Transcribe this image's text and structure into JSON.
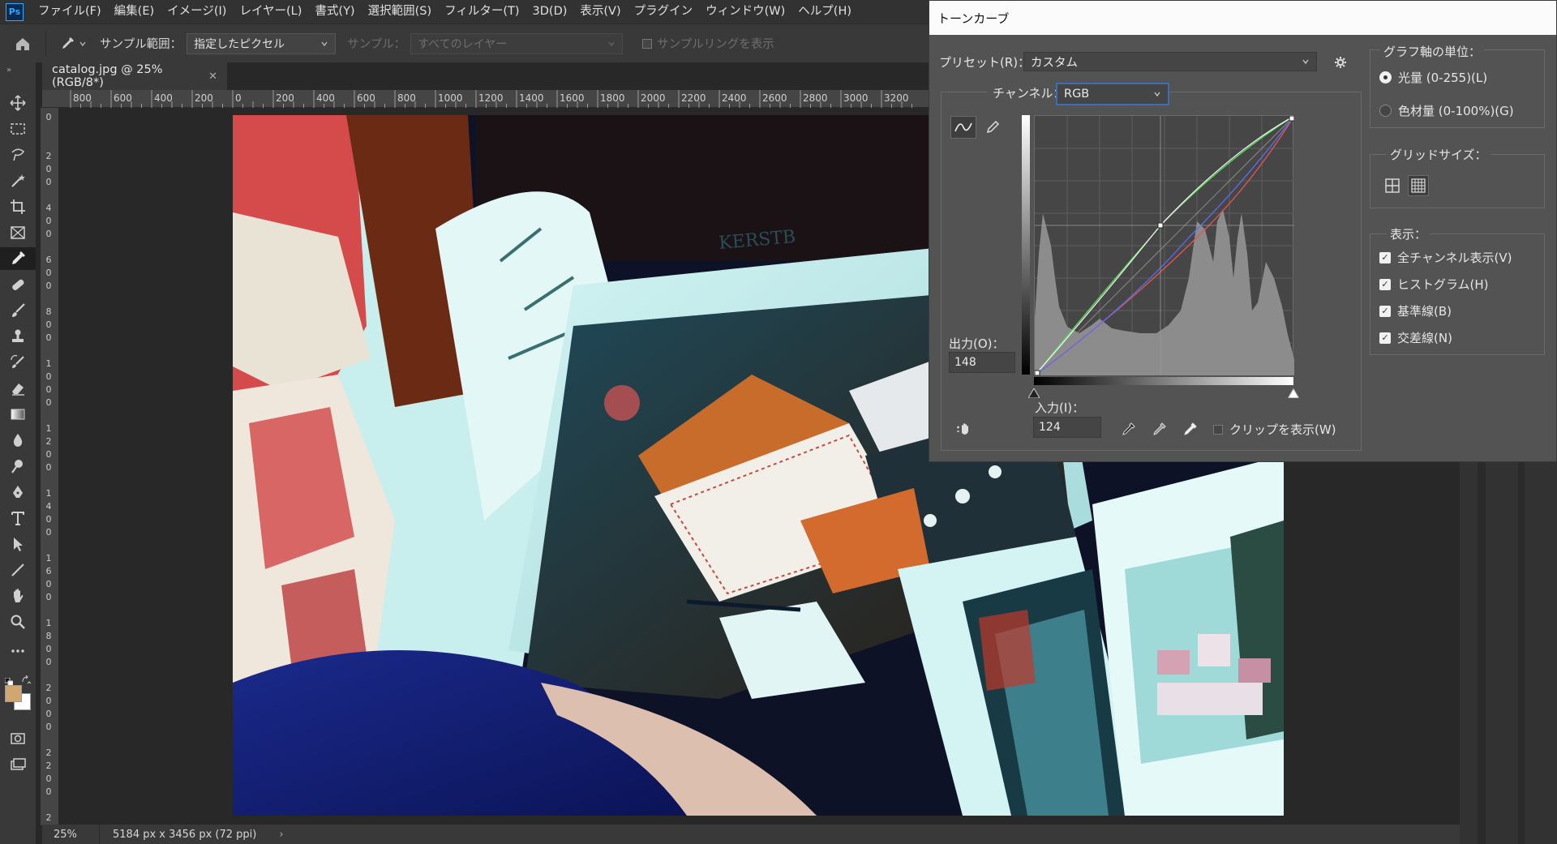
{
  "menubar": {
    "items": [
      "ファイル(F)",
      "編集(E)",
      "イメージ(I)",
      "レイヤー(L)",
      "書式(Y)",
      "選択範囲(S)",
      "フィルター(T)",
      "3D(D)",
      "表示(V)",
      "プラグイン",
      "ウィンドウ(W)",
      "ヘルプ(H)"
    ]
  },
  "options": {
    "sample_size_label": "サンプル範囲：",
    "sample_size_value": "指定したピクセル",
    "sample_label": "サンプル：",
    "sample_value": "すべてのレイヤー",
    "sampling_ring_label": "サンプルリングを表示"
  },
  "document": {
    "tab_title": "catalog.jpg @ 25% (RGB/8*)",
    "zoom": "25%",
    "dimensions": "5184 px x 3456 px (72 ppi)"
  },
  "rulers": {
    "top_ticks": [
      "800",
      "600",
      "400",
      "200",
      "0",
      "200",
      "400",
      "600",
      "800",
      "1000",
      "1200",
      "1400",
      "1600",
      "1800",
      "2000",
      "2200",
      "2400",
      "2600",
      "2800",
      "3000",
      "3200"
    ]
  },
  "colors": {
    "foreground": "#d1a670",
    "background": "#ffffff",
    "accent": "#31a8ff"
  },
  "curves": {
    "title": "トーンカーブ",
    "preset_label": "プリセット(R)：",
    "preset_value": "カスタム",
    "channel_label": "チャンネル：",
    "channel_value": "RGB",
    "output_label": "出力(O)：",
    "output_value": "148",
    "input_label": "入力(I)：",
    "input_value": "124",
    "show_clipping_label": "クリップを表示(W)",
    "graph_units_title": "グラフ軸の単位：",
    "unit_light": "光量 (0-255)(L)",
    "unit_pigment": "色材量 (0-100%)(G)",
    "unit_selected": "light",
    "grid_size_title": "グリッドサイズ：",
    "display_title": "表示：",
    "display_options": [
      {
        "label": "全チャンネル表示(V)",
        "checked": true
      },
      {
        "label": "ヒストグラム(H)",
        "checked": true
      },
      {
        "label": "基準線(B)",
        "checked": true
      },
      {
        "label": "交差線(N)",
        "checked": true
      }
    ]
  }
}
